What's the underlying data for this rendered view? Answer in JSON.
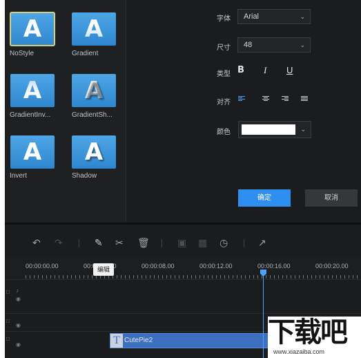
{
  "styles": [
    {
      "name": "NoStyle",
      "glyph": "A"
    },
    {
      "name": "Gradient",
      "glyph": "A"
    },
    {
      "name": "GradientInv...",
      "glyph": "A"
    },
    {
      "name": "GradientSh...",
      "glyph": "A"
    },
    {
      "name": "Invert",
      "glyph": "A"
    },
    {
      "name": "Shadow",
      "glyph": "A"
    }
  ],
  "props": {
    "font_label": "字体",
    "font_value": "Arial",
    "size_label": "尺寸",
    "size_value": "48",
    "type_label": "类型",
    "bold": "B",
    "italic": "I",
    "underline": "U",
    "align_label": "对齐",
    "color_label": "颜色",
    "color_value": "#ffffff"
  },
  "buttons": {
    "ok": "确定",
    "cancel": "取消"
  },
  "timeline": {
    "timecodes": [
      "00:00:00.00",
      "00:00:04.00",
      "00:00:08.00",
      "00:00:12.00",
      "00:00:16.00",
      "00:00:20.00"
    ],
    "tooltip": "编辑",
    "clip_label": "CutePie2",
    "clip_icon": "T"
  },
  "watermark": {
    "big": "下载吧",
    "small": "www.xiazaiba.com"
  },
  "colors": {
    "accent": "#2f8ff0",
    "panel": "#1b1c1e",
    "clip": "#3d6fc0"
  }
}
